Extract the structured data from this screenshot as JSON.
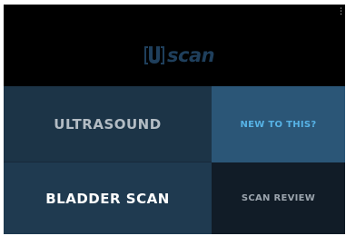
{
  "app": {
    "logo_text": "scan",
    "logo_mark_letter": "U",
    "logo_color": "#1f3f5c"
  },
  "header": {
    "overflow_menu_icon": "vertical-dots-icon"
  },
  "menu": {
    "ultrasound_label": "ULTRASOUND",
    "new_to_this_label": "NEW TO THIS?",
    "bladder_scan_label": "BLADDER SCAN",
    "scan_review_label": "SCAN REVIEW"
  },
  "colors": {
    "ultrasound_bg": "#1c3447",
    "new_to_this_bg": "#2b5677",
    "new_to_this_text": "#57b3e6",
    "bladder_scan_bg": "#1f3a50",
    "scan_review_bg": "#111c27"
  }
}
